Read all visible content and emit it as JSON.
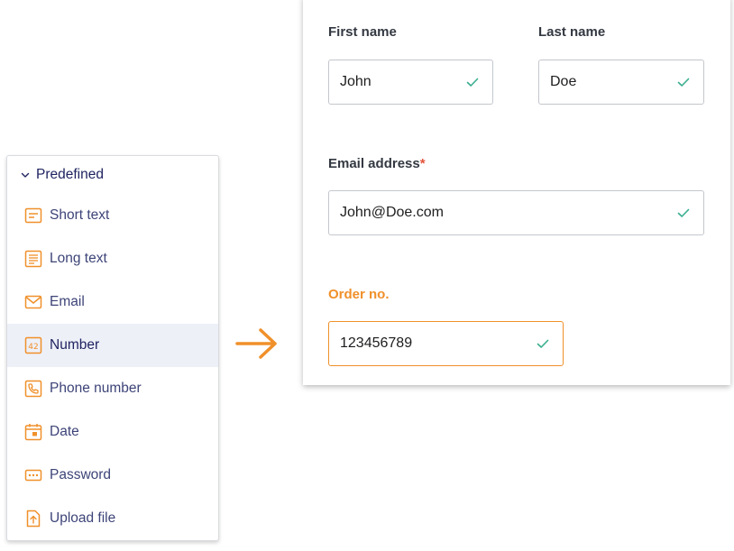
{
  "sidebar": {
    "title": "Predefined",
    "items": [
      {
        "label": "Short text",
        "icon": "short-text-icon"
      },
      {
        "label": "Long text",
        "icon": "long-text-icon"
      },
      {
        "label": "Email",
        "icon": "envelope-icon"
      },
      {
        "label": "Number",
        "icon": "number-42-icon",
        "active": true
      },
      {
        "label": "Phone number",
        "icon": "phone-icon"
      },
      {
        "label": "Date",
        "icon": "calendar-icon"
      },
      {
        "label": "Password",
        "icon": "password-dots-icon"
      },
      {
        "label": "Upload file",
        "icon": "upload-file-icon"
      }
    ]
  },
  "form": {
    "first_name": {
      "label": "First name",
      "value": "John"
    },
    "last_name": {
      "label": "Last name",
      "value": "Doe"
    },
    "email": {
      "label": "Email address",
      "required_mark": "*",
      "value": "John@Doe.com"
    },
    "order": {
      "label": "Order no.",
      "value": "123456789"
    }
  },
  "colors": {
    "accent": "#f0902a",
    "navy": "#1f2360",
    "check": "#3aae8f",
    "required": "#e2543c",
    "active_bg": "#eef0f8"
  }
}
